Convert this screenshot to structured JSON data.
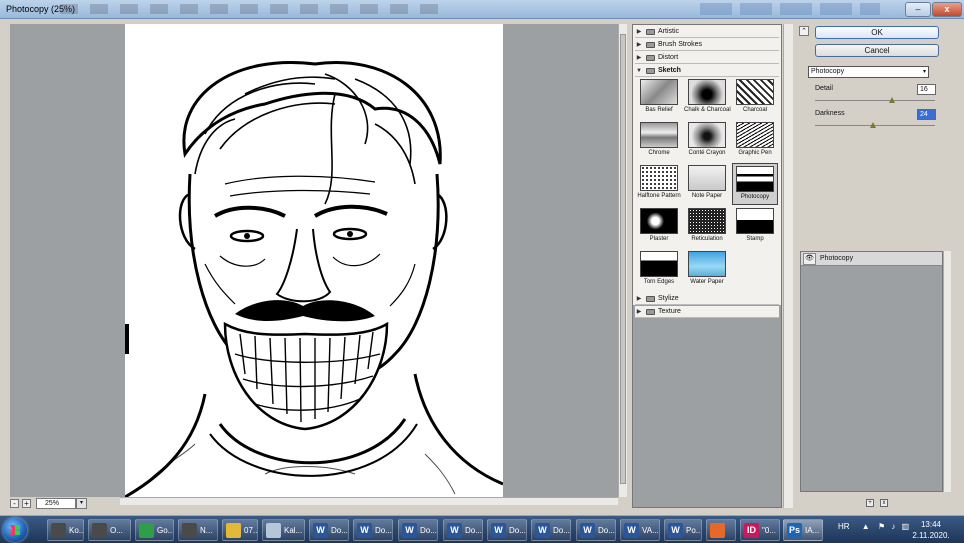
{
  "window": {
    "title": "Photocopy (25%)",
    "min_label": "‒",
    "close_label": "x"
  },
  "zoom": {
    "value": "25%",
    "minus": "-",
    "plus": "+",
    "arrow": "▾"
  },
  "gallery": {
    "folders_top": [
      {
        "label": "Artistic",
        "arrow": "▶"
      },
      {
        "label": "Brush Strokes",
        "arrow": "▶"
      },
      {
        "label": "Distort",
        "arrow": "▶"
      }
    ],
    "open_folder": {
      "label": "Sketch",
      "arrow": "▼"
    },
    "thumbs": [
      {
        "label": "Bas Relief",
        "selected": false
      },
      {
        "label": "Chalk & Charcoal",
        "selected": false
      },
      {
        "label": "Charcoal",
        "selected": false
      },
      {
        "label": "Chrome",
        "selected": false
      },
      {
        "label": "Conté Crayon",
        "selected": false
      },
      {
        "label": "Graphic Pen",
        "selected": false
      },
      {
        "label": "Halftone Pattern",
        "selected": false
      },
      {
        "label": "Note Paper",
        "selected": false
      },
      {
        "label": "Photocopy",
        "selected": true
      },
      {
        "label": "Plaster",
        "selected": false
      },
      {
        "label": "Reticulation",
        "selected": false
      },
      {
        "label": "Stamp",
        "selected": false
      },
      {
        "label": "Torn Edges",
        "selected": false
      },
      {
        "label": "Water Paper",
        "selected": false
      }
    ],
    "folders_bottom": [
      {
        "label": "Stylize",
        "arrow": "▶"
      },
      {
        "label": "Texture",
        "arrow": "▶"
      }
    ]
  },
  "controls": {
    "collapse": "⌃",
    "ok_label": "OK",
    "cancel_label": "Cancel",
    "filter_select": "Photocopy",
    "select_arrow": "▾",
    "detail": {
      "label": "Detail",
      "value": "16",
      "level": 0.64
    },
    "darkness": {
      "label": "Darkness",
      "value": "24",
      "level": 0.48
    }
  },
  "layers": {
    "eye": "👁",
    "name": "Photocopy",
    "new_icon": "+",
    "delete_icon": "x"
  },
  "taskbar": {
    "items": [
      {
        "label": "Ko...",
        "icon": "",
        "color": "#4a4a4a"
      },
      {
        "label": "O...",
        "icon": "",
        "color": "#4a4a4a"
      },
      {
        "label": "Go...",
        "icon": "",
        "color": "#2e9e49"
      },
      {
        "label": "N...",
        "icon": "",
        "color": "#4a4a4a"
      },
      {
        "label": "07...",
        "icon": "",
        "color": "#e3b93a"
      },
      {
        "label": "Kal...",
        "icon": "",
        "color": "#b5c6d8"
      },
      {
        "label": "Do...",
        "icon": "W",
        "color": "#2b579a"
      },
      {
        "label": "Do...",
        "icon": "W",
        "color": "#2b579a"
      },
      {
        "label": "Do...",
        "icon": "W",
        "color": "#2b579a"
      },
      {
        "label": "Do...",
        "icon": "W",
        "color": "#2b579a"
      },
      {
        "label": "Do...",
        "icon": "W",
        "color": "#2b579a"
      },
      {
        "label": "Do...",
        "icon": "W",
        "color": "#2b579a"
      },
      {
        "label": "Do...",
        "icon": "W",
        "color": "#2b579a"
      },
      {
        "label": "VA...",
        "icon": "W",
        "color": "#2b579a"
      },
      {
        "label": "Po...",
        "icon": "W",
        "color": "#2b579a"
      },
      {
        "label": "",
        "icon": "",
        "color": "#e6692b"
      },
      {
        "label": "\"0...",
        "icon": "ID",
        "color": "#c8195e"
      },
      {
        "label": "IA...",
        "icon": "Ps",
        "color": "#1c66b7"
      }
    ],
    "language": "HR",
    "time": "13:44",
    "date": "2.11.2020."
  }
}
